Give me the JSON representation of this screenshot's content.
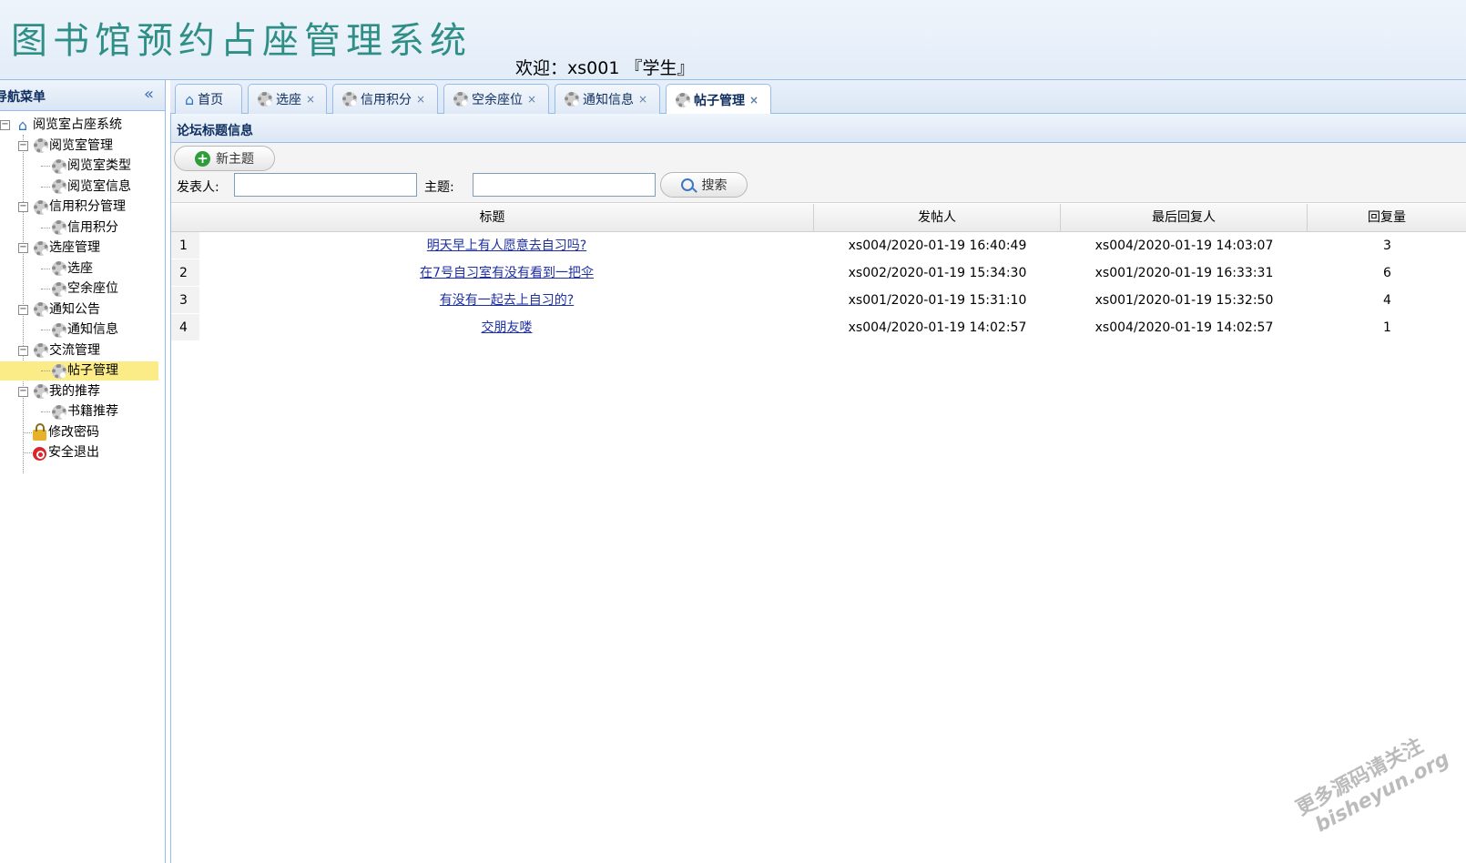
{
  "header": {
    "app_title": "图书馆预约占座管理系统",
    "welcome": "欢迎：xs001 『学生』"
  },
  "sidebar": {
    "title": "导航菜单",
    "root": "阅览室占座系统",
    "groups": [
      {
        "label": "阅览室管理",
        "items": [
          "阅览室类型",
          "阅览室信息"
        ]
      },
      {
        "label": "信用积分管理",
        "items": [
          "信用积分"
        ]
      },
      {
        "label": "选座管理",
        "items": [
          "选座",
          "空余座位"
        ]
      },
      {
        "label": "通知公告",
        "items": [
          "通知信息"
        ]
      },
      {
        "label": "交流管理",
        "items": [
          "帖子管理"
        ]
      },
      {
        "label": "我的推荐",
        "items": [
          "书籍推荐"
        ]
      }
    ],
    "change_password": "修改密码",
    "logout": "安全退出",
    "selected_item": "帖子管理"
  },
  "tabs": [
    {
      "label": "首页",
      "icon": "home-icon",
      "closable": false
    },
    {
      "label": "选座",
      "icon": "gear-icon",
      "closable": true
    },
    {
      "label": "信用积分",
      "icon": "gear-icon",
      "closable": true
    },
    {
      "label": "空余座位",
      "icon": "gear-icon",
      "closable": true
    },
    {
      "label": "通知信息",
      "icon": "gear-icon",
      "closable": true
    },
    {
      "label": "帖子管理",
      "icon": "gear-icon",
      "closable": true,
      "active": true
    }
  ],
  "tab_close_glyph": "×",
  "panel": {
    "title": "论坛标题信息",
    "new_topic_label": "新主题",
    "poster_label": "发表人:",
    "subject_label": "主题:",
    "poster_value": "",
    "subject_value": "",
    "search_label": "搜索"
  },
  "grid": {
    "columns": [
      "标题",
      "发帖人",
      "最后回复人",
      "回复量"
    ],
    "rows": [
      {
        "num": "1",
        "title": "明天早上有人愿意去自习吗?",
        "poster": "xs004/2020-01-19 16:40:49",
        "last_reply": "xs004/2020-01-19 14:03:07",
        "replies": "3"
      },
      {
        "num": "2",
        "title": "在7号自习室有没有看到一把伞",
        "poster": "xs002/2020-01-19 15:34:30",
        "last_reply": "xs001/2020-01-19 16:33:31",
        "replies": "6"
      },
      {
        "num": "3",
        "title": "有没有一起去上自习的?",
        "poster": "xs001/2020-01-19 15:31:10",
        "last_reply": "xs001/2020-01-19 15:32:50",
        "replies": "4"
      },
      {
        "num": "4",
        "title": "交朋友喽",
        "poster": "xs004/2020-01-19 14:02:57",
        "last_reply": "xs004/2020-01-19 14:02:57",
        "replies": "1"
      }
    ]
  },
  "watermark": {
    "line1": "更多源码请关注",
    "line2": "bisheyun.org"
  },
  "colors": {
    "accent_border": "#99bbe8",
    "title_teal": "#2f8f86",
    "link": "#1e2fa0",
    "selected": "#fbec88"
  }
}
